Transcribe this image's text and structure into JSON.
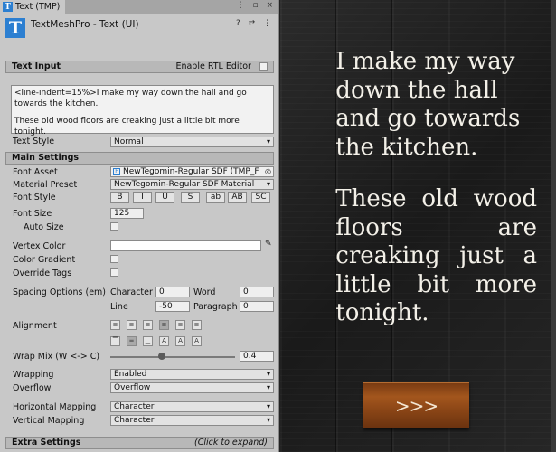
{
  "tab": {
    "title": "Text (TMP)",
    "icons": "⋮ ▫ ×"
  },
  "component": {
    "title": "TextMeshPro - Text (UI)",
    "icons": "? ⇄ ⋮"
  },
  "text_input": {
    "header": "Text Input",
    "rtl_label": "Enable RTL Editor",
    "line1": "<line-indent=15%>I make my way down the hall and go towards the kitchen.",
    "line2": "These old wood floors are creaking just a little bit more tonight."
  },
  "text_style": {
    "label": "Text Style",
    "value": "Normal"
  },
  "main_settings": {
    "header": "Main Settings",
    "font_asset_label": "Font Asset",
    "font_asset_value": "NewTegomin-Regular SDF (TMP_F",
    "material_label": "Material Preset",
    "material_value": "NewTegomin-Regular SDF Material",
    "font_style_label": "Font Style",
    "style_buttons": [
      "B",
      "I",
      "U",
      "S",
      "ab",
      "AB",
      "SC"
    ],
    "font_size_label": "Font Size",
    "font_size_value": "125",
    "auto_size_label": "Auto Size",
    "vertex_color_label": "Vertex Color",
    "color_gradient_label": "Color Gradient",
    "override_tags_label": "Override Tags",
    "spacing_label": "Spacing Options (em)",
    "character_label": "Character",
    "character_value": "0",
    "word_label": "Word",
    "word_value": "0",
    "line_label": "Line",
    "line_value": "-50",
    "paragraph_label": "Paragraph",
    "paragraph_value": "0",
    "alignment_label": "Alignment",
    "wrap_mix_label": "Wrap Mix (W <-> C)",
    "wrap_mix_value": "0.4",
    "wrapping_label": "Wrapping",
    "wrapping_value": "Enabled",
    "overflow_label": "Overflow",
    "overflow_value": "Overflow",
    "hmap_label": "Horizontal Mapping",
    "hmap_value": "Character",
    "vmap_label": "Vertical Mapping",
    "vmap_value": "Character"
  },
  "extra_settings": {
    "header": "Extra Settings",
    "hint": "(Click to expand)"
  },
  "game": {
    "paragraph1": "I make my way down the hall and go towards the kitchen.",
    "paragraph2": "These old wood floors are creaking just a little bit more tonight.",
    "button_label": ">>>"
  }
}
